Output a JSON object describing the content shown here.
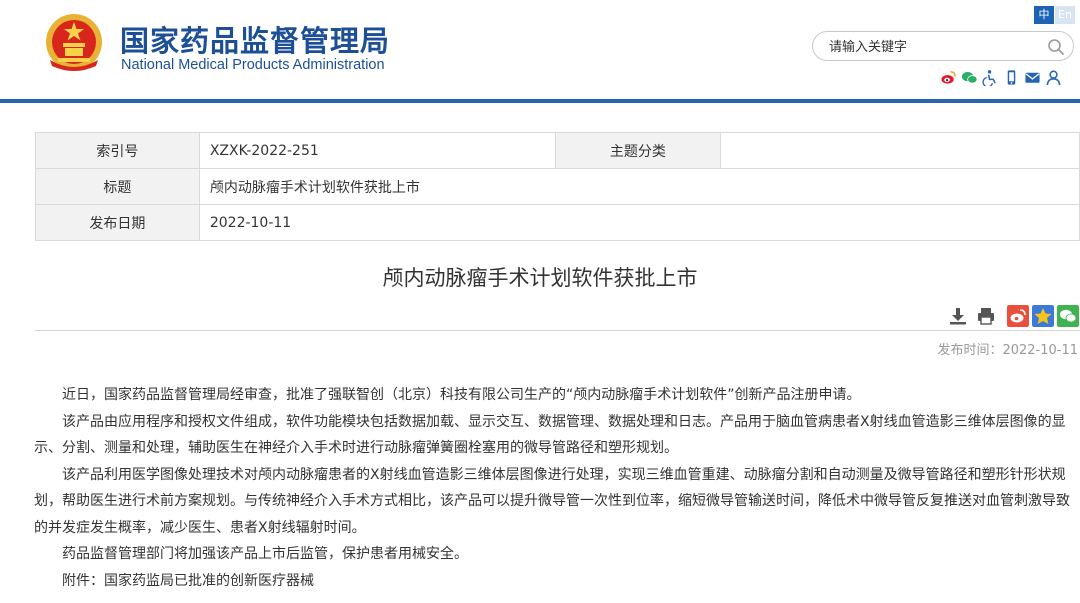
{
  "header": {
    "title_cn": "国家药品监督管理局",
    "title_en": "National Medical Products Administration",
    "lang_zh": "中",
    "lang_en": "En",
    "search_placeholder": "请输入关键字",
    "brand_color": "#1d4f96",
    "rule_color": "#2a64ad",
    "social_icons": [
      "weibo-icon",
      "wechat-icon",
      "accessibility-icon",
      "mobile-icon",
      "email-icon",
      "user-icon"
    ]
  },
  "meta": {
    "index_label": "索引号",
    "index_value": "XZXK-2022-251",
    "topic_label": "主题分类",
    "topic_value": "",
    "title_label": "标题",
    "title_value": "颅内动脉瘤手术计划软件获批上市",
    "date_label": "发布日期",
    "date_value": "2022-10-11"
  },
  "article": {
    "title": "颅内动脉瘤手术计划软件获批上市",
    "published": "发布时间：2022-10-11",
    "paragraphs": [
      "近日，国家药品监督管理局经审查，批准了强联智创（北京）科技有限公司生产的“颅内动脉瘤手术计划软件”创新产品注册申请。",
      "该产品由应用程序和授权文件组成，软件功能模块包括数据加载、显示交互、数据管理、数据处理和日志。产品用于脑血管病患者X射线血管造影三维体层图像的显示、分割、测量和处理，辅助医生在神经介入手术时进行动脉瘤弹簧圈栓塞用的微导管路径和塑形规划。",
      "该产品利用医学图像处理技术对颅内动脉瘤患者的X射线血管造影三维体层图像进行处理，实现三维血管重建、动脉瘤分割和自动测量及微导管路径和塑形针形状规划，帮助医生进行术前方案规划。与传统神经介入手术方式相比，该产品可以提升微导管一次性到位率，缩短微导管输送时间，降低术中微导管反复推送对血管刺激导致的并发症发生概率，减少医生、患者X射线辐射时间。",
      "药品监督管理部门将加强该产品上市后监管，保护患者用械安全。",
      "附件：国家药监局已批准的创新医疗器械"
    ]
  },
  "tools": {
    "icons": [
      "download-icon",
      "print-icon"
    ],
    "share_icons": [
      "weibo-share-icon",
      "favorite-share-icon",
      "wechat-share-icon"
    ]
  }
}
